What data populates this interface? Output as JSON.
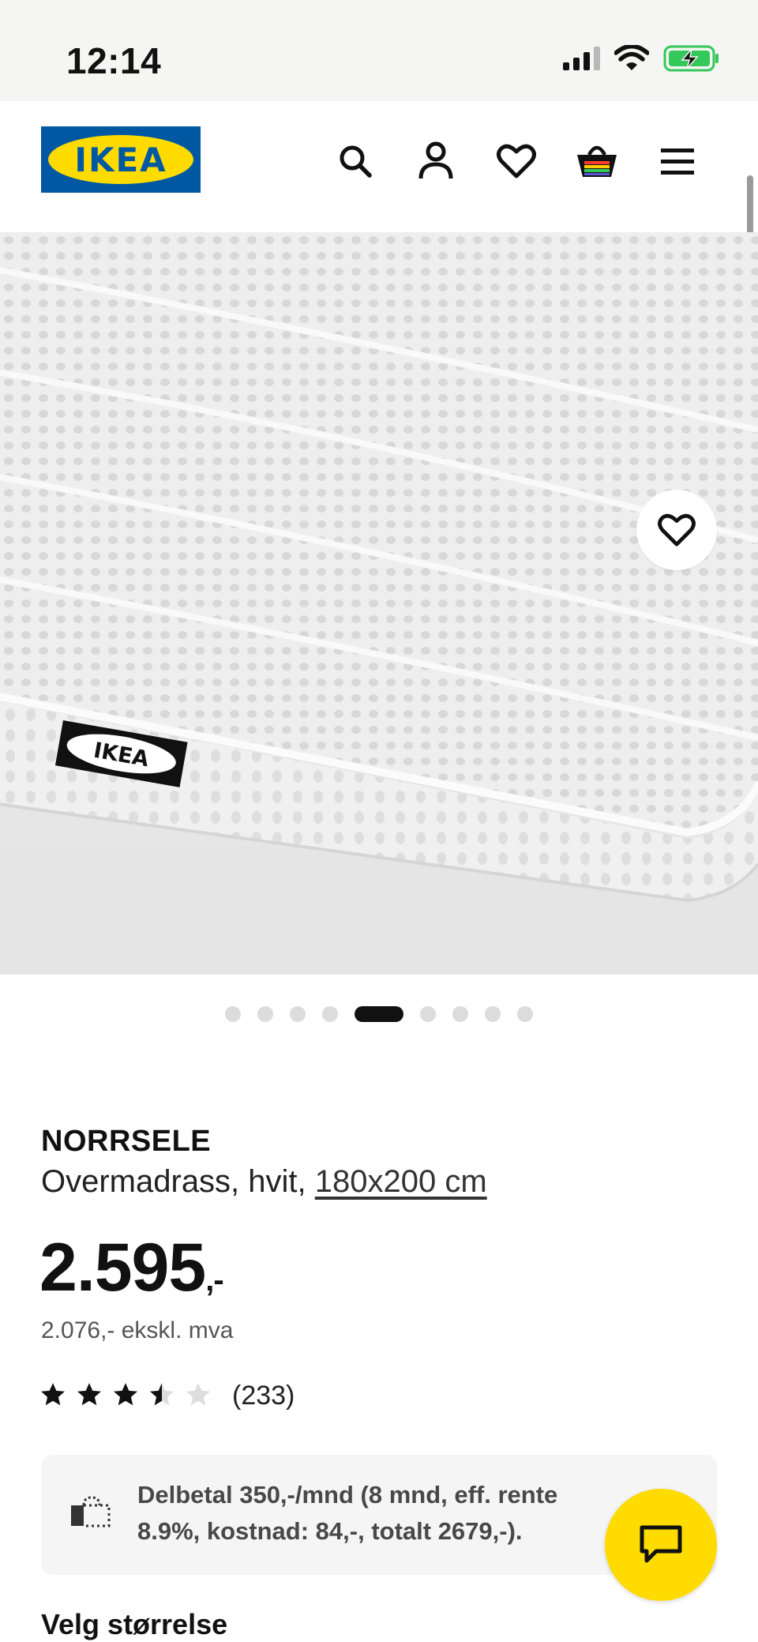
{
  "status_bar": {
    "time": "12:14",
    "icons": [
      "signal-icon",
      "wifi-icon",
      "battery-charging-icon"
    ],
    "battery_color": "#34c759"
  },
  "header": {
    "logo_text": "IKEA",
    "brand_colors": {
      "blue": "#0058a3",
      "yellow": "#ffdb00"
    },
    "icons": [
      "search-icon",
      "profile-icon",
      "favourites-heart-icon",
      "shopping-bag-icon",
      "menu-icon"
    ]
  },
  "gallery": {
    "image_subject": "white quilted mattress topper with IKEA label",
    "label_text": "IKEA",
    "total_images": 9,
    "active_index": 5,
    "favourite_icon": "heart-icon"
  },
  "product": {
    "name": "NORRSELE",
    "description_prefix": "Overmadrass, hvit,",
    "size_link": "180x200 cm",
    "price_main": "2.595",
    "price_suffix": ",-",
    "price_ex_vat": "2.076,- ekskl. mva",
    "rating": {
      "value": 3.5,
      "max": 5,
      "count_label": "(233)"
    }
  },
  "finance": {
    "text": "Delbetal 350,-/mnd (8 mnd, eff. rente 8.9%, kostnad: 84,-, totalt 2679,-).",
    "icon": "installment-payment-icon"
  },
  "chat": {
    "icon": "chat-bubble-icon",
    "color": "#ffdb00"
  },
  "sections": {
    "choose_size": "Velg størrelse"
  }
}
